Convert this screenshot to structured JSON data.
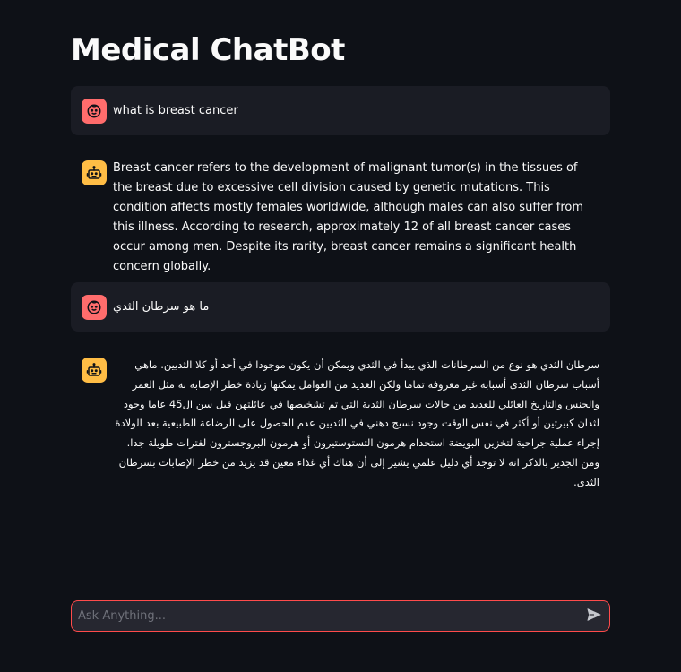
{
  "page": {
    "title": "Medical ChatBot"
  },
  "messages": [
    {
      "role": "user",
      "avatar_icon": "user-face-icon",
      "avatar_color": "#ff6c6c",
      "text": "what is breast cancer"
    },
    {
      "role": "assistant",
      "avatar_icon": "robot-icon",
      "avatar_color": "#ffbd45",
      "text": "Breast cancer refers to the development of malignant tumor(s) in the tissues of the breast due to excessive cell division caused by genetic mutations. This condition affects mostly females worldwide, although males can also suffer from this illness. According to research, approximately 12 of all breast cancer cases occur among men. Despite its rarity, breast cancer remains a significant health concern globally."
    },
    {
      "role": "user",
      "avatar_icon": "user-face-icon",
      "avatar_color": "#ff6c6c",
      "text": "ما هو سرطان الثدي"
    },
    {
      "role": "assistant",
      "avatar_icon": "robot-icon",
      "avatar_color": "#ffbd45",
      "text": "سرطان الثدي هو نوع من السرطانات الذي يبدأ في الثدي ويمكن أن يكون موجودا في أحد أو كلا الثديين. ماهي أسباب سرطان الثدى أسبابه غير معروفة تماما ولكن العديد من العوامل يمكنها زيادة خطر الإصابة به مثل العمر والجنس والتاريخ العائلي للعديد من حالات سرطان الثدية التي تم تشخيصها في عائلتهن قبل سن ال45 عاما وجود لثدان كبيرتين أو أكثر في نفس الوقت وجود نسيج دهني في الثديين عدم الحصول على الرضاعة الطبيعية بعد الولادة إجراء عملية جراحية لتخزين البويضة استخدام هرمون التستوستيرون أو هرمون البروجسترون لفترات طويلة جدا. ومن الجدير بالذكر انه لا توجد أي دليل علمي يشير إلى أن هناك أي غذاء معين قد يزيد من خطر الإصابات بسرطان الثدى."
    }
  ],
  "chat_input": {
    "placeholder": "Ask Anything...",
    "value": "",
    "send_icon": "send-icon",
    "border_color": "#ff4b4b"
  }
}
